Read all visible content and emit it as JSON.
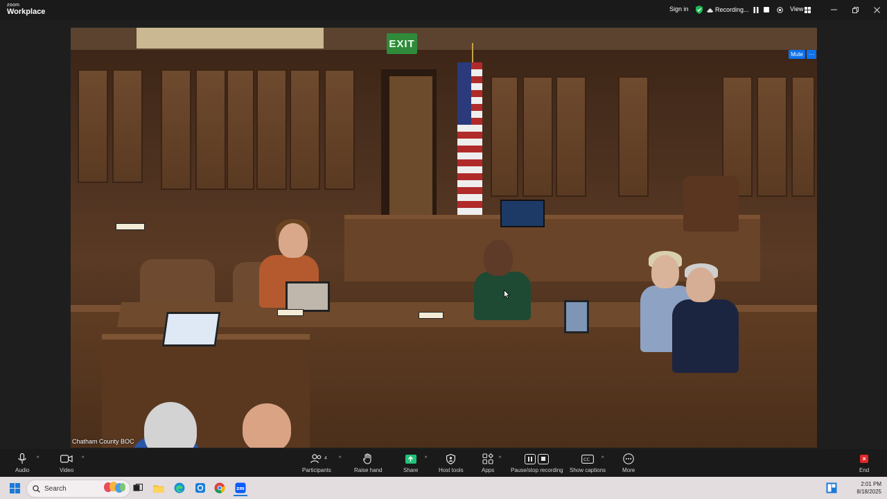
{
  "titlebar": {
    "brand_small": "zoom",
    "brand_big": "Workplace",
    "sign_in": "Sign in",
    "recording": "Recording...",
    "view": "View"
  },
  "video": {
    "participant_label": "Chatham County BOC",
    "exit_sign": "EXIT",
    "mute_button": "Mute",
    "more_button": "···"
  },
  "toolbar": {
    "audio": "Audio",
    "video": "Video",
    "participants": "Participants",
    "participants_count": "4",
    "raise_hand": "Raise hand",
    "share": "Share",
    "host_tools": "Host tools",
    "apps": "Apps",
    "pause_stop_recording": "Pause/stop recording",
    "show_captions": "Show captions",
    "more": "More",
    "end": "End"
  },
  "taskbar": {
    "search_placeholder": "Search",
    "time": "2:01 PM",
    "date": "8/18/2025"
  },
  "colors": {
    "accent_blue": "#0e71eb",
    "share_green": "#23c27a",
    "end_red": "#e02828",
    "shield_green": "#1db954"
  }
}
